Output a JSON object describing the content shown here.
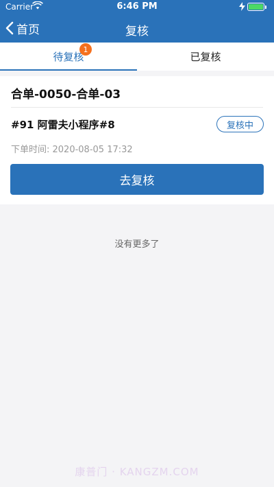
{
  "status_bar": {
    "carrier": "Carrier",
    "time": "6:46 PM",
    "icons": {
      "wifi": "wifi-icon",
      "battery": "battery-icon",
      "charging": "charging-bolt-icon"
    }
  },
  "nav": {
    "back_label": "首页",
    "title": "复核",
    "back_icon": "chevron-left-icon"
  },
  "tabs": [
    {
      "label": "待复核",
      "badge": "1",
      "active": true
    },
    {
      "label": "已复核",
      "active": false
    }
  ],
  "order": {
    "title": "合单-0050-合单-03",
    "line": "#91 阿雷夫小程序#8",
    "status": "复核中",
    "time": "下单时间: 2020-08-05 17:32",
    "action_label": "去复核"
  },
  "footer": {
    "no_more": "没有更多了",
    "watermark": "康普门 · KANGZM.COM"
  },
  "colors": {
    "primary": "#2a72b9",
    "badge": "#f5701e",
    "battery": "#4cd964",
    "background": "#f4f4f6"
  }
}
